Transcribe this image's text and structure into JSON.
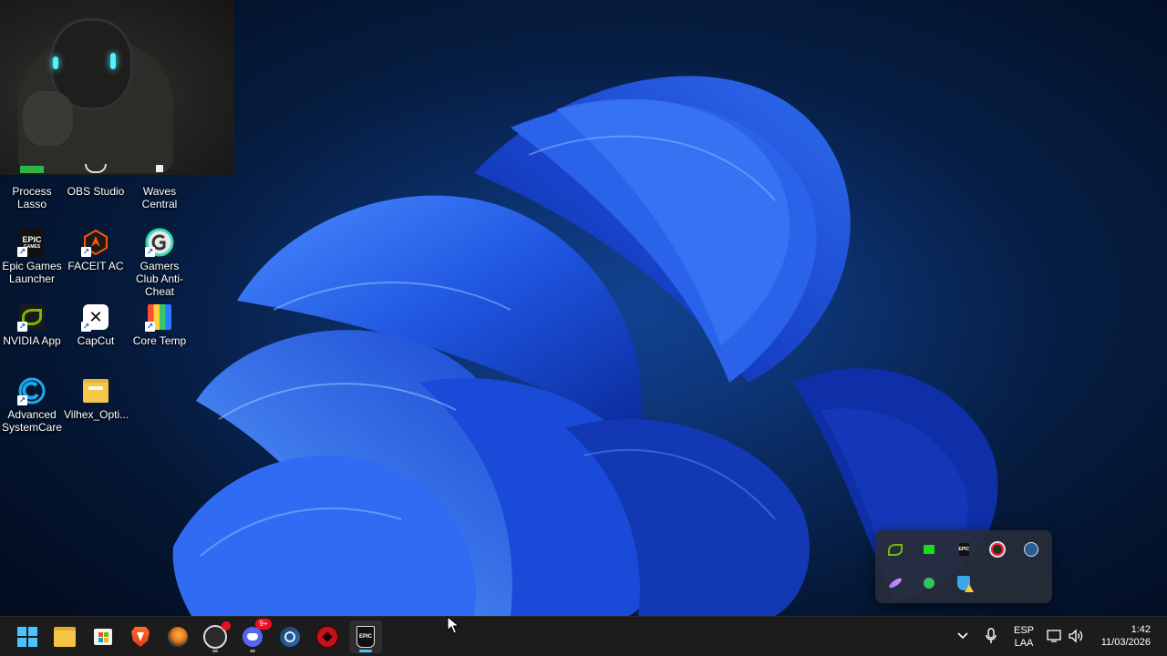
{
  "desktop": {
    "icons": [
      {
        "label": "Process Lasso",
        "icon": "process-lasso-icon"
      },
      {
        "label": "OBS Studio",
        "icon": "obs-studio-icon"
      },
      {
        "label": "Waves Central",
        "icon": "waves-central-icon"
      },
      {
        "label": "Epic Games Launcher",
        "icon": "epic-games-icon"
      },
      {
        "label": "FACEIT AC",
        "icon": "faceit-icon"
      },
      {
        "label": "Gamers Club Anti-Cheat",
        "icon": "gamers-club-icon"
      },
      {
        "label": "NVIDIA App",
        "icon": "nvidia-icon"
      },
      {
        "label": "CapCut",
        "icon": "capcut-icon"
      },
      {
        "label": "Core Temp",
        "icon": "core-temp-icon"
      },
      {
        "label": "Advanced SystemCare",
        "icon": "advanced-systemcare-icon"
      },
      {
        "label": "Vilhex_Opti...",
        "icon": "folder-icon"
      }
    ],
    "epic_logo_text": "EPIC",
    "epic_sub_text": "GAMES"
  },
  "tray_popup": {
    "icons": [
      "nvidia-icon",
      "green-app-icon",
      "epic-games-icon",
      "obs-studio-icon",
      "steam-icon",
      "feather-icon",
      "green-circle-icon",
      "defender-warning-icon"
    ]
  },
  "taskbar": {
    "apps": [
      {
        "name": "start-icon",
        "active": false
      },
      {
        "name": "file-explorer-icon",
        "active": false
      },
      {
        "name": "microsoft-store-icon",
        "active": false
      },
      {
        "name": "brave-icon",
        "active": false
      },
      {
        "name": "fl-studio-icon",
        "active": false
      },
      {
        "name": "obs-studio-icon",
        "active": true
      },
      {
        "name": "discord-icon",
        "active": true
      },
      {
        "name": "steam-icon",
        "active": false
      },
      {
        "name": "gamers-club-icon",
        "active": false
      },
      {
        "name": "epic-games-icon",
        "active": true
      }
    ],
    "discord_badge": "9+",
    "language_top": "ESP",
    "language_bottom": "LAA",
    "time": "1:42",
    "date": "11/03/2026"
  },
  "colors": {
    "accent": "#4cc2ff",
    "taskbar_bg": "#1c1c1c",
    "wallpaper_blue": "#1e5bd6"
  }
}
